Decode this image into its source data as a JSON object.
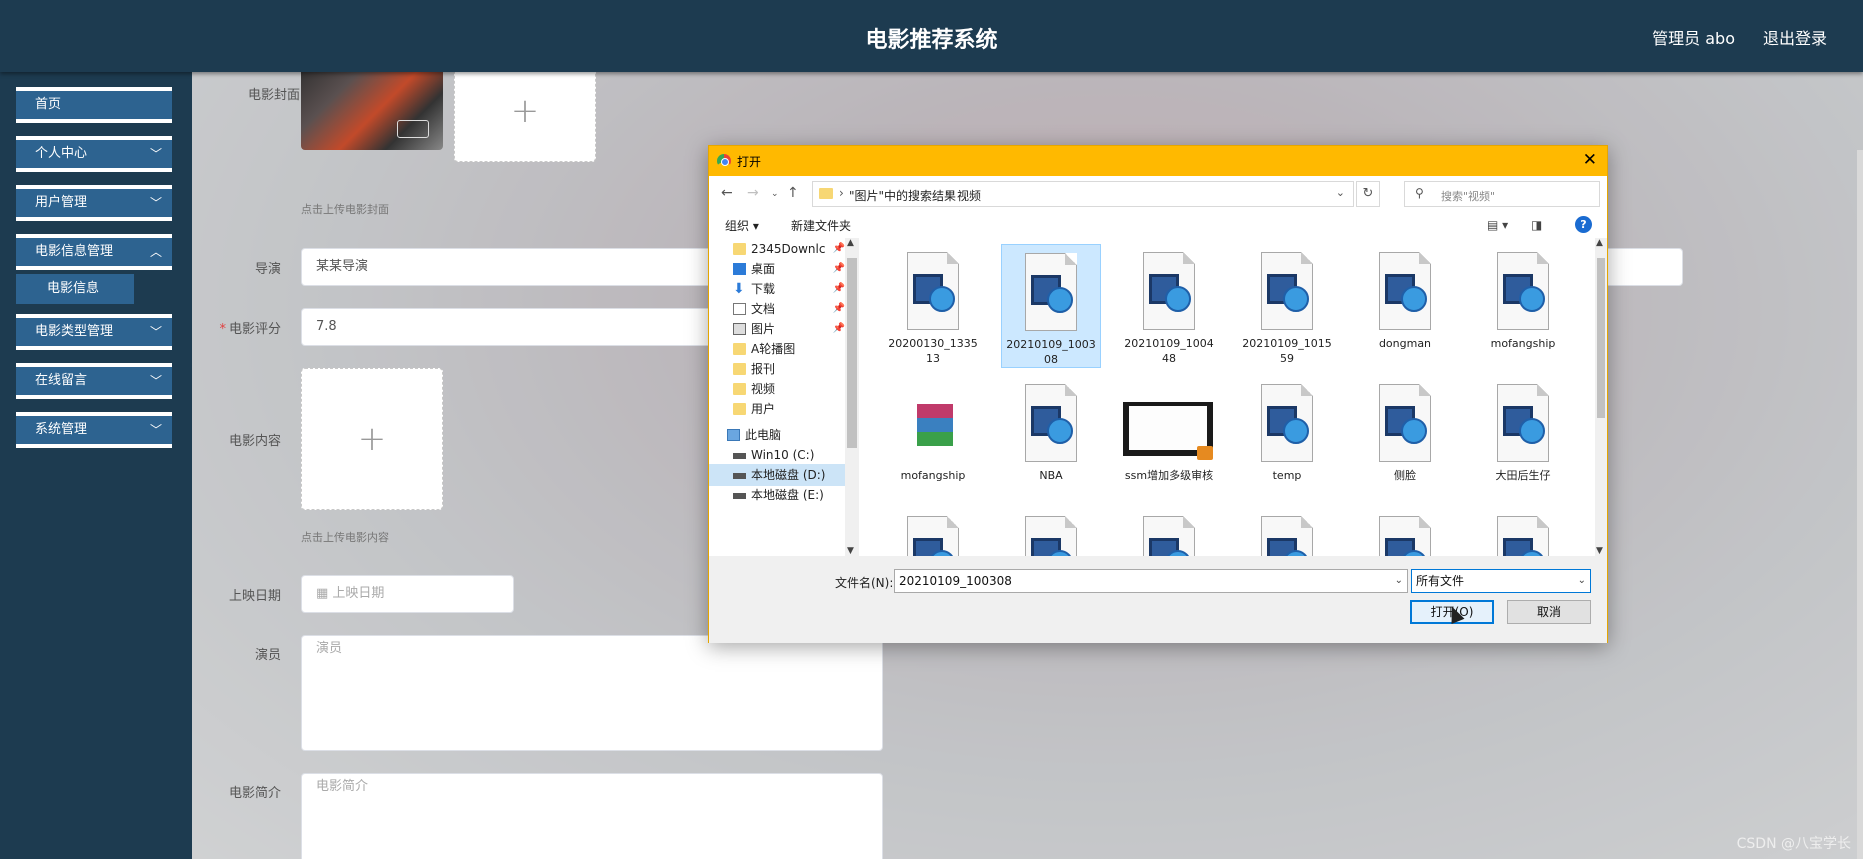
{
  "header": {
    "title": "电影推荐系统",
    "admin_label": "管理员 abo",
    "logout_label": "退出登录"
  },
  "sidebar": {
    "items": [
      {
        "label": "首页",
        "has_children": false
      },
      {
        "label": "个人中心",
        "has_children": true
      },
      {
        "label": "用户管理",
        "has_children": true
      },
      {
        "label": "电影信息管理",
        "has_children": true
      },
      {
        "label": "电影类型管理",
        "has_children": true
      },
      {
        "label": "在线留言",
        "has_children": true
      },
      {
        "label": "系统管理",
        "has_children": true
      }
    ],
    "submenu": {
      "label": "电影信息"
    }
  },
  "form": {
    "cover_label": "电影封面",
    "cover_hint": "点击上传电影封面",
    "director_label": "导演",
    "director_value": "某某导演",
    "rating_label": "电影评分",
    "rating_value": "7.8",
    "content_label": "电影内容",
    "content_hint": "点击上传电影内容",
    "release_label": "上映日期",
    "release_placeholder": "上映日期",
    "actors_label": "演员",
    "actors_placeholder": "演员",
    "intro_label": "电影简介",
    "intro_placeholder": "电影简介"
  },
  "dialog": {
    "title": "打开",
    "breadcrumb": [
      "\"图片\"中的搜索结果",
      "视频"
    ],
    "search_placeholder": "搜索\"视频\"",
    "toolbar": {
      "organize": "组织 ▾",
      "new_folder": "新建文件夹"
    },
    "nav_items": [
      {
        "label": "2345Downlc",
        "icon": "folder-icon",
        "pinned": true
      },
      {
        "label": "桌面",
        "icon": "desktop-icon",
        "pinned": true
      },
      {
        "label": "下载",
        "icon": "download-icon",
        "pinned": true
      },
      {
        "label": "文档",
        "icon": "document-icon",
        "pinned": true
      },
      {
        "label": "图片",
        "icon": "picture-icon",
        "pinned": true
      },
      {
        "label": "A轮播图",
        "icon": "folder-icon",
        "pinned": false
      },
      {
        "label": "报刊",
        "icon": "folder-icon",
        "pinned": false
      },
      {
        "label": "视频",
        "icon": "folder-icon",
        "pinned": false
      },
      {
        "label": "用户",
        "icon": "folder-icon",
        "pinned": false
      },
      {
        "label": "此电脑",
        "icon": "computer-icon",
        "pinned": false
      },
      {
        "label": "Win10 (C:)",
        "icon": "drive-icon",
        "pinned": false
      },
      {
        "label": "本地磁盘 (D:)",
        "icon": "drive-icon",
        "pinned": false,
        "selected": true
      },
      {
        "label": "本地磁盘 (E:)",
        "icon": "drive-icon",
        "pinned": false
      }
    ],
    "files": [
      {
        "name": "20200130_133513",
        "type": "video"
      },
      {
        "name": "20210109_100308",
        "type": "video",
        "selected": true
      },
      {
        "name": "20210109_100448",
        "type": "video"
      },
      {
        "name": "20210109_101559",
        "type": "video"
      },
      {
        "name": "dongman",
        "type": "video"
      },
      {
        "name": "mofangship",
        "type": "video"
      },
      {
        "name": "mofangship",
        "type": "archive"
      },
      {
        "name": "NBA",
        "type": "video"
      },
      {
        "name": "ssm增加多级审核",
        "type": "video-thumb"
      },
      {
        "name": "temp",
        "type": "video"
      },
      {
        "name": "侧脸",
        "type": "video"
      },
      {
        "name": "大田后生仔",
        "type": "video"
      },
      {
        "name": "",
        "type": "video"
      },
      {
        "name": "",
        "type": "video"
      },
      {
        "name": "",
        "type": "video"
      },
      {
        "name": "",
        "type": "video"
      },
      {
        "name": "",
        "type": "video"
      },
      {
        "name": "",
        "type": "video"
      }
    ],
    "filename_label": "文件名(N):",
    "filename_value": "20210109_100308",
    "filetype_value": "所有文件",
    "open_label": "打开(O)",
    "cancel_label": "取消"
  },
  "watermark": "CSDN @八宝学长"
}
